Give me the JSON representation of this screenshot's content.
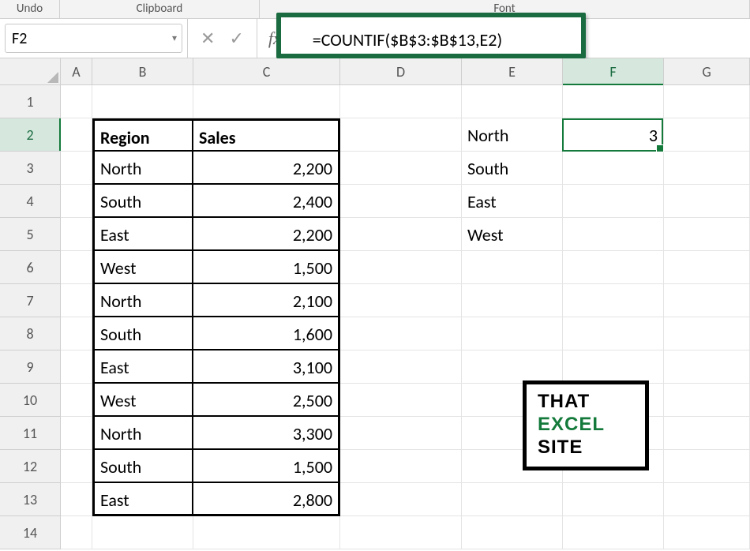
{
  "ribbon": {
    "undo": "Undo",
    "clipboard": "Clipboard",
    "font": "Font"
  },
  "namebox": "F2",
  "formula": "=COUNTIF($B$3:$B$13,E2)",
  "fx_label": "fx",
  "columns": [
    "A",
    "B",
    "C",
    "D",
    "E",
    "F",
    "G"
  ],
  "rows": [
    "1",
    "2",
    "3",
    "4",
    "5",
    "6",
    "7",
    "8",
    "9",
    "10",
    "11",
    "12",
    "13",
    "14"
  ],
  "table": {
    "headers": {
      "region": "Region",
      "sales": "Sales"
    },
    "data": [
      {
        "region": "North",
        "sales": "2,200"
      },
      {
        "region": "South",
        "sales": "2,400"
      },
      {
        "region": "East",
        "sales": "2,200"
      },
      {
        "region": "West",
        "sales": "1,500"
      },
      {
        "region": "North",
        "sales": "2,100"
      },
      {
        "region": "South",
        "sales": "1,600"
      },
      {
        "region": "East",
        "sales": "3,100"
      },
      {
        "region": "West",
        "sales": "2,500"
      },
      {
        "region": "North",
        "sales": "3,300"
      },
      {
        "region": "South",
        "sales": "1,500"
      },
      {
        "region": "East",
        "sales": "2,800"
      }
    ]
  },
  "lookup": {
    "items": [
      "North",
      "South",
      "East",
      "West"
    ],
    "result": "3"
  },
  "logo": {
    "line1": "THAT",
    "line2": "EXCEL",
    "line3": "SITE"
  }
}
